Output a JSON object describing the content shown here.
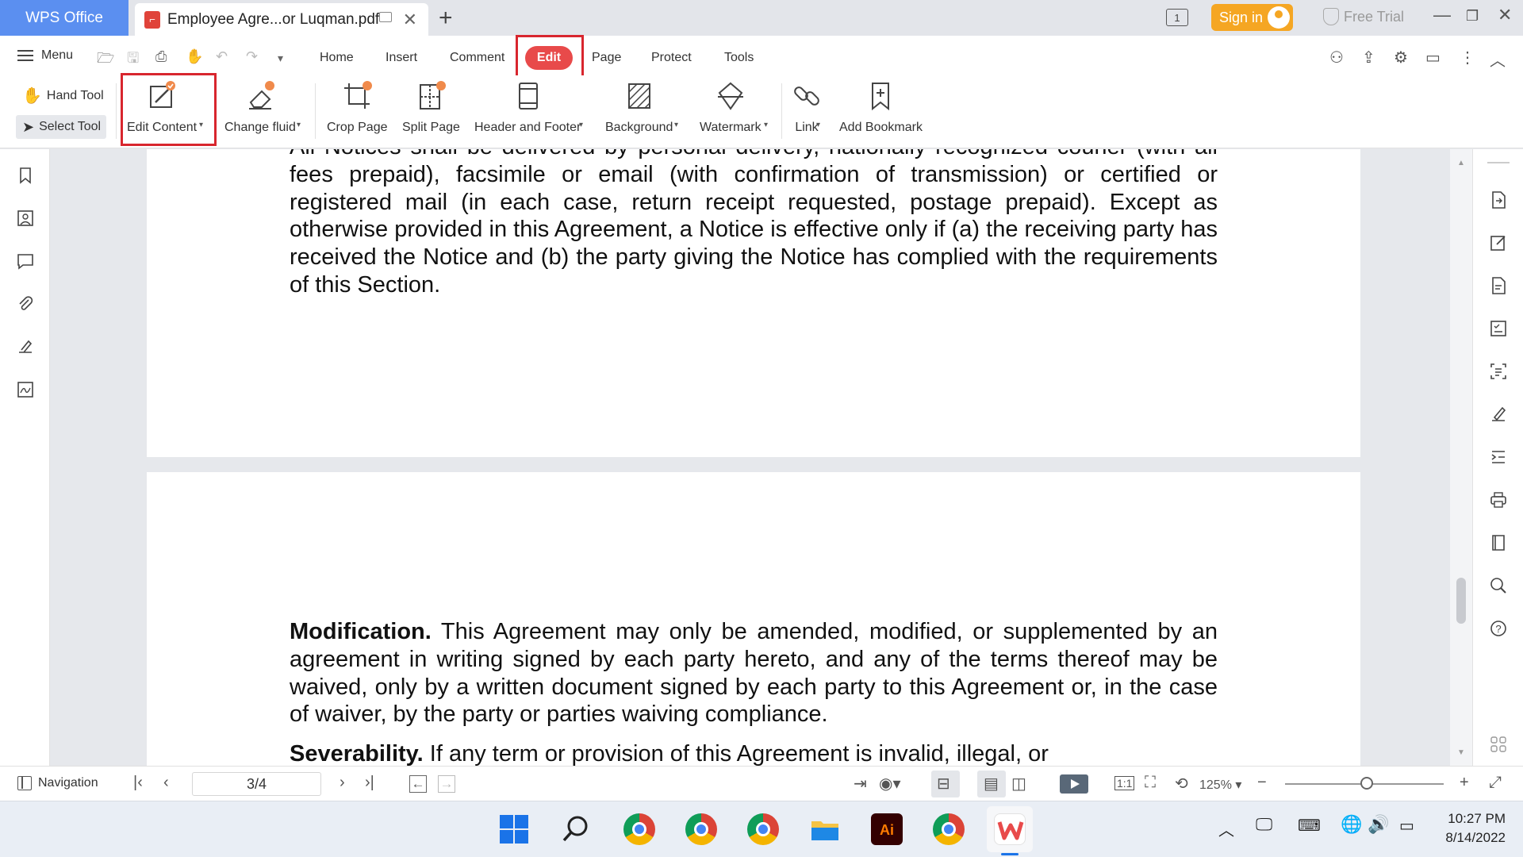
{
  "titlebar": {
    "app_tab": "WPS Office",
    "doc_tab": "Employee Agre...or Luqman.pdf",
    "win_count": "1",
    "signin": "Sign in",
    "free_trial": "Free Trial"
  },
  "menubar": {
    "menu_label": "Menu",
    "tabs": [
      "Home",
      "Insert",
      "Comment",
      "Edit",
      "Page",
      "Protect",
      "Tools"
    ],
    "active_tab": "Edit"
  },
  "ribbon": {
    "hand_tool": "Hand Tool",
    "select_tool": "Select Tool",
    "items": [
      {
        "label": "Edit Content",
        "icon": "edit-content-icon",
        "dropdown": true,
        "highlighted": true
      },
      {
        "label": "Change fluid",
        "icon": "eraser-icon",
        "dropdown": true
      },
      {
        "label": "Crop Page",
        "icon": "crop-page-icon",
        "dropdown": false
      },
      {
        "label": "Split Page",
        "icon": "split-page-icon",
        "dropdown": false
      },
      {
        "label": "Header and Footer",
        "icon": "header-footer-icon",
        "dropdown": true
      },
      {
        "label": "Background",
        "icon": "background-icon",
        "dropdown": true
      },
      {
        "label": "Watermark",
        "icon": "watermark-icon",
        "dropdown": true
      },
      {
        "label": "Link",
        "icon": "link-icon",
        "dropdown": true
      },
      {
        "label": "Add Bookmark",
        "icon": "add-bookmark-icon",
        "dropdown": false
      }
    ]
  },
  "document": {
    "page1_text": "All Notices shall be delivered by personal delivery, nationally recognized courier (with all fees prepaid), facsimile or email (with confirmation of transmission) or certified or registered mail (in each case, return receipt requested, postage prepaid). Except as otherwise provided in this Agreement, a Notice is effective only if (a) the receiving party has received the Notice and (b) the party giving the Notice has complied with the requirements of this Section.",
    "modification_heading": "Modification.",
    "modification_text": " This Agreement may only be amended, modified, or supplemented by an agreement in writing signed by each party hereto, and any of the terms thereof may be waived, only by a written document signed by each party to this Agreement or, in the case of waiver, by the party or parties waiving compliance.",
    "severability_heading": "Severability.",
    "severability_text": " If any term or provision of this Agreement is invalid, illegal, or"
  },
  "statusbar": {
    "navigation": "Navigation",
    "page_indicator": "3/4",
    "zoom": "125%"
  },
  "taskbar": {
    "time": "10:27 PM",
    "date": "8/14/2022"
  },
  "colors": {
    "accent_blue": "#5b8ff0",
    "edit_tab_red": "#e84a4a",
    "highlight_box": "#d8262e",
    "signin_orange": "#f5a623"
  }
}
